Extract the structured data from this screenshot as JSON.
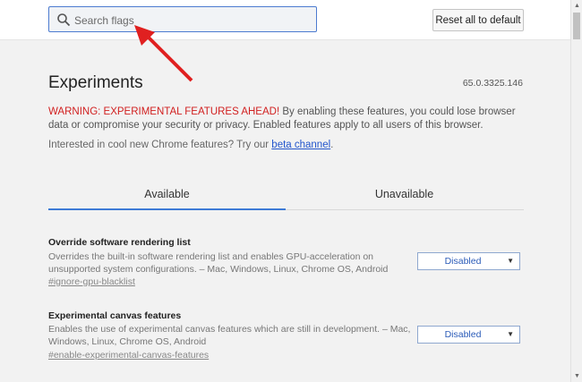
{
  "search": {
    "placeholder": "Search flags",
    "value": ""
  },
  "header": {
    "reset_label": "Reset all to default"
  },
  "main": {
    "title": "Experiments",
    "version": "65.0.3325.146",
    "warning_red": "WARNING: EXPERIMENTAL FEATURES AHEAD!",
    "warning_text": " By enabling these features, you could lose browser data or compromise your security or privacy. Enabled features apply to all users of this browser.",
    "interested_text": "Interested in cool new Chrome features? Try our ",
    "interested_link": "beta channel",
    "interested_end": "."
  },
  "tabs": [
    {
      "label": "Available",
      "active": true
    },
    {
      "label": "Unavailable",
      "active": false
    }
  ],
  "experiments": [
    {
      "title": "Override software rendering list",
      "description": "Overrides the built-in software rendering list and enables GPU-acceleration on unsupported system configurations. – Mac, Windows, Linux, Chrome OS, Android",
      "link": "#ignore-gpu-blacklist",
      "selected": "Disabled"
    },
    {
      "title": "Experimental canvas features",
      "description": "Enables the use of experimental canvas features which are still in development. – Mac, Windows, Linux, Chrome OS, Android",
      "link": "#enable-experimental-canvas-features",
      "selected": "Disabled"
    }
  ],
  "colors": {
    "accent": "#3e7bd6",
    "warning": "#d11f1f",
    "annotation_arrow": "#e02020"
  },
  "icons": {
    "search": "search-icon",
    "arrow": "annotation-arrow-icon"
  }
}
